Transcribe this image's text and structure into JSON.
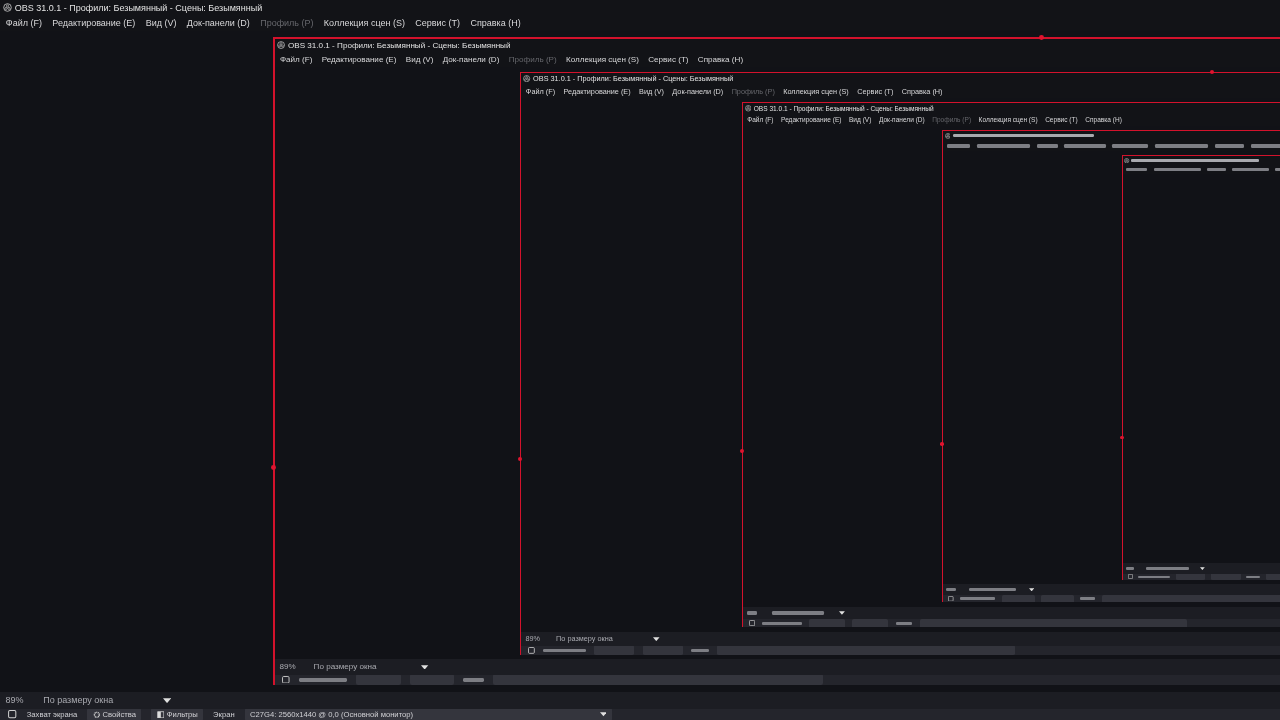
{
  "windows": [
    {
      "kind": "detailed",
      "title": "OBS 31.0.1 - Профили: Безымянный - Сцены: Безымянный",
      "menu": [
        {
          "label": "Файл (F)",
          "disabled": false
        },
        {
          "label": "Редактирование (E)",
          "disabled": false
        },
        {
          "label": "Вид (V)",
          "disabled": false
        },
        {
          "label": "Док-панели (D)",
          "disabled": false
        },
        {
          "label": "Профиль (P)",
          "disabled": true
        },
        {
          "label": "Коллекция сцен (S)",
          "disabled": false
        },
        {
          "label": "Сервис (T)",
          "disabled": false
        },
        {
          "label": "Справка (H)",
          "disabled": false
        }
      ],
      "zoom": "89%",
      "scale_mode": "По размеру окна",
      "toolbar": [
        {
          "kind": "source",
          "label": "Захват экрана"
        },
        {
          "kind": "gear",
          "label": "Свойства"
        },
        {
          "kind": "filter",
          "label": "Фильтры"
        },
        {
          "kind": "label",
          "label": "Экран"
        },
        {
          "kind": "dropdown",
          "label": "C27G4: 2560x1440 @ 0,0 (Основной монитор)"
        }
      ]
    },
    {
      "kind": "detailed",
      "title": "OBS 31.0.1 - Профили: Безымянный - Сцены: Безымянный",
      "menu": [
        {
          "label": "Файл (F)",
          "disabled": false
        },
        {
          "label": "Редактирование (E)",
          "disabled": false
        },
        {
          "label": "Вид (V)",
          "disabled": false
        },
        {
          "label": "Док-панели (D)",
          "disabled": false
        },
        {
          "label": "Профиль (P)",
          "disabled": true
        },
        {
          "label": "Коллекция сцен (S)",
          "disabled": false
        },
        {
          "label": "Сервис (T)",
          "disabled": false
        },
        {
          "label": "Справка (H)",
          "disabled": false
        }
      ],
      "zoom": "89%",
      "scale_mode": "По размеру окна"
    },
    {
      "kind": "detailed",
      "title": "OBS 31.0.1 - Профили: Безымянный - Сцены: Безымянный",
      "menu": [
        {
          "label": "Файл (F)",
          "disabled": false
        },
        {
          "label": "Редактирование (E)",
          "disabled": false
        },
        {
          "label": "Вид (V)",
          "disabled": false
        },
        {
          "label": "Док-панели (D)",
          "disabled": false
        },
        {
          "label": "Профиль (P)",
          "disabled": true
        },
        {
          "label": "Коллекция сцен (S)",
          "disabled": false
        },
        {
          "label": "Сервис (T)",
          "disabled": false
        },
        {
          "label": "Справка (H)",
          "disabled": false
        }
      ],
      "zoom": "89%",
      "scale_mode": "По размеру окна"
    },
    {
      "kind": "detailed",
      "title": "OBS 31.0.1 - Профили: Безымянный - Сцены: Безымянный",
      "menu": [
        {
          "label": "Файл (F)",
          "disabled": false
        },
        {
          "label": "Редактирование (E)",
          "disabled": false
        },
        {
          "label": "Вид (V)",
          "disabled": false
        },
        {
          "label": "Док-панели (D)",
          "disabled": false
        },
        {
          "label": "Профиль (P)",
          "disabled": true
        },
        {
          "label": "Коллекция сцен (S)",
          "disabled": false
        },
        {
          "label": "Сервис (T)",
          "disabled": false
        },
        {
          "label": "Справка (H)",
          "disabled": false
        }
      ]
    },
    {
      "kind": "blurred"
    },
    {
      "kind": "blurred"
    }
  ]
}
